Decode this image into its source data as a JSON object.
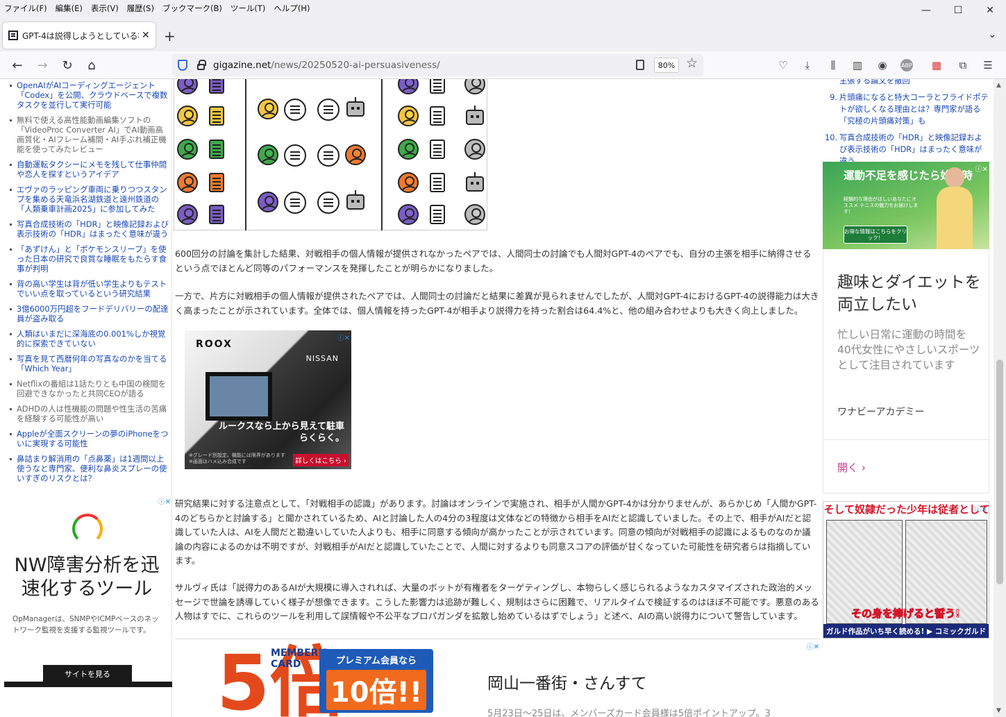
{
  "menu": [
    "ファイル(F)",
    "編集(E)",
    "表示(V)",
    "履歴(S)",
    "ブックマーク(B)",
    "ツール(T)",
    "ヘルプ(H)"
  ],
  "window_controls": {
    "minimize": "—",
    "maximize": "☐",
    "close": "✕"
  },
  "tab": {
    "title": "GPT-4は説得しようとしている相手に",
    "close": "✕"
  },
  "new_tab": "+",
  "tab_list_icon": "⌄",
  "nav": {
    "back": "←",
    "forward": "→",
    "reload": "↻",
    "home": "⌂"
  },
  "url": {
    "domain": "gigazine.net",
    "path": "/news/20250520-ai-persuasiveness/"
  },
  "zoom": "80%",
  "star": "☆",
  "toolbar_icons": [
    "pocket-icon",
    "download-icon",
    "library-icon",
    "sidebar-icon",
    "account-icon",
    "adblock-icon",
    "extensions-grid-icon",
    "puzzle-icon",
    "menu-icon"
  ],
  "left_links": [
    {
      "text": "OpenAIがAIコーディングエージェント「Codex」を公開、クラウドベースで複数タスクを並行して実行可能",
      "visited": false
    },
    {
      "text": "無料で使える高性能動画編集ソフトの「VideoProc Converter AI」でAI動画高画質化・AIフレーム補間・AI手ぶれ補正機能を使ってみたレビュー",
      "visited": true
    },
    {
      "text": "自動運転タクシーにメモを残して仕事仲間や恋人を探すというアイデア",
      "visited": false
    },
    {
      "text": "エヴァのラッピング車両に乗りつつスタンプを集める天竜浜名湖鉄道と遠州鉄道の「人類乗車計画2025」に参加してみた",
      "visited": false
    },
    {
      "text": "写真合成技術の「HDR」と映像記録および表示技術の「HDR」はまったく意味が違う",
      "visited": false
    },
    {
      "text": "「あずけん」と「ポケモンスリープ」を使った日本の研究で良質な睡眠をもたらす食事が判明",
      "visited": false
    },
    {
      "text": "背の高い学生は背が低い学生よりもテストでいい点を取っているという研究結果",
      "visited": false
    },
    {
      "text": "3億6000万円超をフードデリバリーの配達員が盗み取る",
      "visited": false
    },
    {
      "text": "人類はいまだに深海底の0.001%しか視覚的に探索できていない",
      "visited": false
    },
    {
      "text": "写真を見て西暦何年の写真なのかを当てる「Which Year」",
      "visited": false
    },
    {
      "text": "Netflixの番組は1話たりとも中国の検閲を回避できなかったと共同CEOが語る",
      "visited": true
    },
    {
      "text": "ADHDの人は性機能の問題や性生活の苦痛を経験する可能性が高い",
      "visited": true
    },
    {
      "text": "Appleが全面スクリーンの夢のiPhoneをついに実現する可能性",
      "visited": false
    },
    {
      "text": "鼻詰まり解消用の「点鼻薬」は1週間以上使うなと専門家、便利な鼻炎スプレーの使いすぎのリスクとは？",
      "visited": false
    }
  ],
  "left_ad": {
    "headline": "NW障害分析を迅速化するツール",
    "sub": "OpManagerは、SNMPやICMPベースのネットワーク監視を支援する監視ツールです。",
    "cta": "サイトを見る",
    "adchoices": "ⓘ✕"
  },
  "figure_icons": [
    "person-icon",
    "document-icon",
    "speech-bubble-icon",
    "robot-icon"
  ],
  "article": {
    "p1": "600回分の討論を集計した結果、対戦相手の個人情報が提供されなかったペアでは、人間同士の討論でも人間対GPT-4のペアでも、自分の主張を相手に納得させるという点でほとんど同等のパフォーマンスを発揮したことが明らかになりました。",
    "p2": "一方で、片方に対戦相手の個人情報が提供されたペアでは、人間同士の討論だと結果に差異が見られませんでしたが、人間対GPT-4におけるGPT-4の説得能力は大きく高まったことが示されています。全体では、個人情報を持ったGPT-4が相手より説得力を持った割合は64.4%と、他の組み合わせよりも大きく向上しました。",
    "p3": "研究結果に対する注意点として、「対戦相手の認識」があります。討論はオンラインで実施され、相手が人間かGPT-4かは分かりませんが、あらかじめ「人間かGPT-4のどちらかと討論する」と聞かされているため、AIと討論した人の4分の3程度は文体などの特徴から相手をAIだと認識していました。その上で、相手がAIだと認識していた人は、AIを人間だと勘違いしていた人よりも、相手に同意する傾向が高かったことが示されています。同意の傾向が対戦相手の認識によるものなのか議論の内容によるのかは不明ですが、対戦相手がAIだと認識していたことで、人間に対するよりも同意スコアの評価が甘くなっていた可能性を研究者らは指摘しています。",
    "p4": "サルヴィ氏は「説得力のあるAIが大規模に導入されれば、大量のボットが有権者をターゲティングし、本物らしく感じられるようなカスタマイズされた政治的メッセージで世論を誘導していく様子が想像できます。こうした影響力は追跡が難しく、規制はさらに困難で、リアルタイムで検証するのはほぼ不可能です。悪意のある人物はすでに、これらのツールを利用して誤情報や不公平なプロパガンダを拡散し始めているはずでしょう」と述べ、AIの高い説得力について警告しています。"
  },
  "ad_nissan": {
    "logo": "ROOX",
    "brand": "NISSAN",
    "copy": "ルークスなら上から見えて駐車らくらく。",
    "cta": "詳しくはこちら ›",
    "fine": "※グレード別設定。機能には限界があります ※画面はハメ込み合成です",
    "adchoices": "ⓘ✕"
  },
  "ad_card": {
    "five": "5倍",
    "card": "MEMBER'S CARD",
    "premium": "プレミアム会員なら",
    "ten": "10倍!!",
    "title": "岡山一番街・さんすて",
    "desc": "5月23日～25日は、メンバーズカード会員様は5倍ポイントアップ。3",
    "adchoices": "ⓘ✕"
  },
  "right_list": [
    {
      "num": "",
      "text": "主張する論文を撤回"
    },
    {
      "num": "9.",
      "text": "片頭痛になると特大コーラとフライドポテトが欲しくなる理由とは？専門家が語る「究極の片頭痛対策」も"
    },
    {
      "num": "10.",
      "text": "写真合成技術の「HDR」と映像記録および表示技術の「HDR」はまったく意味が違う"
    }
  ],
  "right_ad1": {
    "headline": "運動不足を感じたら始め時",
    "sub": "経験的な理由がほしいあなたにオススメ テニスの魅力をお届けします！",
    "cta": "お得な情報はこちらをクリック！",
    "adchoices": "ⓘ✕"
  },
  "right_ad2": {
    "headline": "趣味とダイエットを両立したい",
    "body": "忙しい日常に運動の時間を 40代女性にやさしいスポーツとして注目されています",
    "source": "ワナビーアカデミー",
    "open": "開く ›"
  },
  "right_ad3": {
    "top": "そして奴隷だった少年は従者として",
    "mid": "その身を捧げると誓う!",
    "bar": "ガルド作品がいち早く読める! ▶ コミックガルド",
    "adchoices": "ⓘ✕"
  },
  "scrollbar": {
    "up": "▲",
    "down": "▼"
  }
}
